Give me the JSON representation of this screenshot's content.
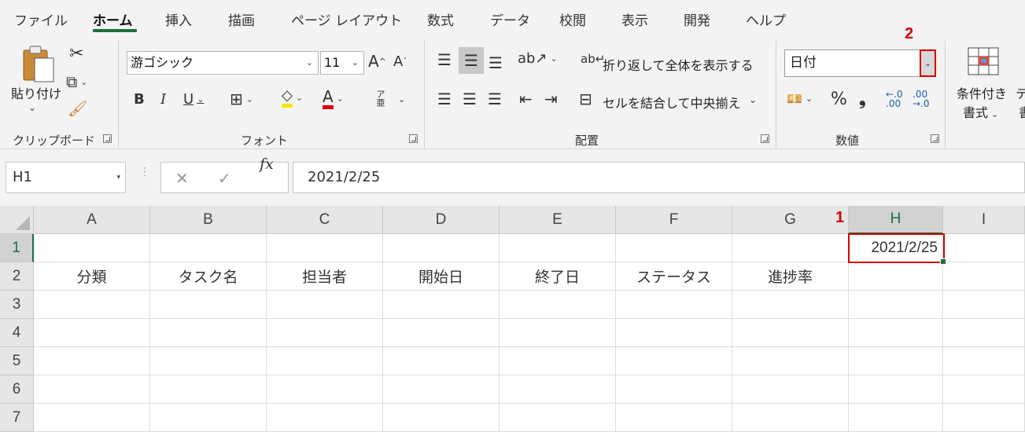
{
  "ribbon_tabs": [
    {
      "label": "ファイル"
    },
    {
      "label": "ホーム"
    },
    {
      "label": "挿入"
    },
    {
      "label": "描画"
    },
    {
      "label": "ページ レイアウト"
    },
    {
      "label": "数式"
    },
    {
      "label": "データ"
    },
    {
      "label": "校閲"
    },
    {
      "label": "表示"
    },
    {
      "label": "開発"
    },
    {
      "label": "ヘルプ"
    }
  ],
  "active_tab": "ホーム",
  "clipboard": {
    "paste_label": "貼り付け",
    "group_label": "クリップボード"
  },
  "font": {
    "name": "游ゴシック",
    "size": "11",
    "group_label": "フォント",
    "furigana": "ア亜"
  },
  "alignment": {
    "wrap_label": "折り返して全体を表示する",
    "merge_label": "セルを結合して中央揃え",
    "group_label": "配置"
  },
  "number": {
    "format_value": "日付",
    "group_label": "数値",
    "percent": "%",
    "comma": "❟"
  },
  "styles": {
    "conditional_line1": "条件付き",
    "conditional_line2": "書式",
    "cut_off_1": "テ",
    "cut_off_2": "書"
  },
  "callouts": {
    "first": "1",
    "second": "2"
  },
  "formula_bar": {
    "name_box": "H1",
    "fx": "fx",
    "formula": "2021/2/25"
  },
  "columns": [
    "A",
    "B",
    "C",
    "D",
    "E",
    "F",
    "G",
    "H",
    "I"
  ],
  "rows": [
    "1",
    "2",
    "3",
    "4",
    "5",
    "6",
    "7"
  ],
  "cells": {
    "H1": "2021/2/25",
    "A2": "分類",
    "B2": "タスク名",
    "C2": "担当者",
    "D2": "開始日",
    "E2": "終了日",
    "F2": "ステータス",
    "G2": "進捗率"
  },
  "colors": {
    "accent": "#1d6f42",
    "highlight_red": "#d40000",
    "ribbon_bg": "#f3f3f3"
  }
}
